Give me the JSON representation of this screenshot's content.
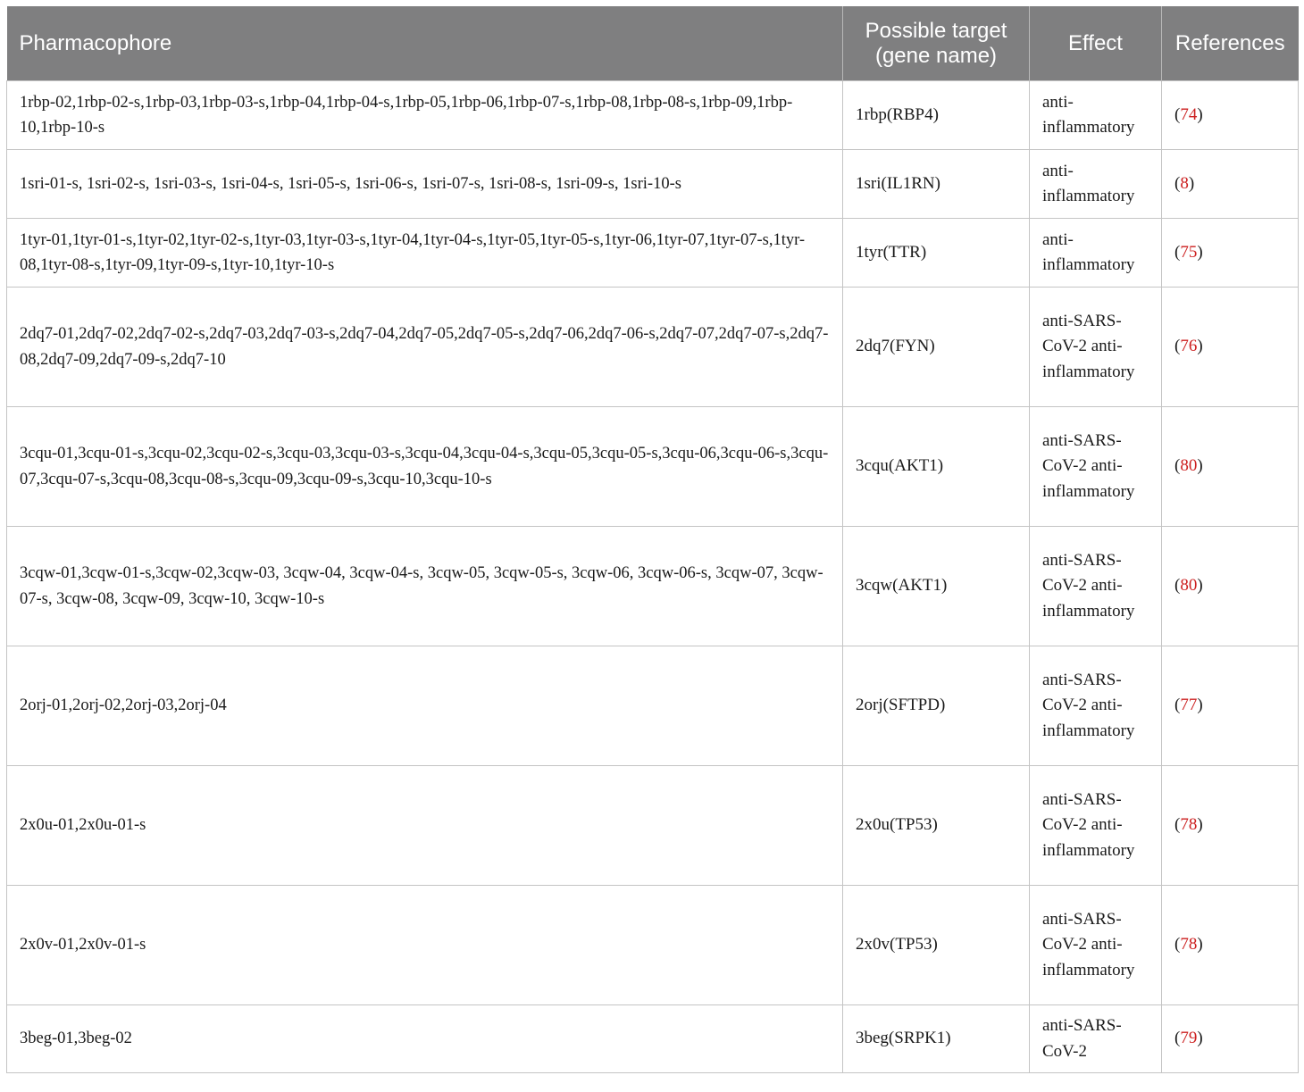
{
  "table": {
    "headers": [
      "Pharmacophore",
      "Possible target (gene name)",
      "Effect",
      "References"
    ],
    "rows": [
      {
        "pharmacophore": "1rbp-02,1rbp-02-s,1rbp-03,1rbp-03-s,1rbp-04,1rbp-04-s,1rbp-05,1rbp-06,1rbp-07-s,1rbp-08,1rbp-08-s,1rbp-09,1rbp-10,1rbp-10-s",
        "target": "1rbp(RBP4)",
        "effect": "anti-inflammatory",
        "ref": "74"
      },
      {
        "pharmacophore": "1sri-01-s, 1sri-02-s, 1sri-03-s, 1sri-04-s, 1sri-05-s, 1sri-06-s, 1sri-07-s, 1sri-08-s, 1sri-09-s, 1sri-10-s",
        "target": "1sri(IL1RN)",
        "effect": "anti-inflammatory",
        "ref": "8"
      },
      {
        "pharmacophore": "1tyr-01,1tyr-01-s,1tyr-02,1tyr-02-s,1tyr-03,1tyr-03-s,1tyr-04,1tyr-04-s,1tyr-05,1tyr-05-s,1tyr-06,1tyr-07,1tyr-07-s,1tyr-08,1tyr-08-s,1tyr-09,1tyr-09-s,1tyr-10,1tyr-10-s",
        "target": "1tyr(TTR)",
        "effect": "anti-inflammatory",
        "ref": "75"
      },
      {
        "pharmacophore": "2dq7-01,2dq7-02,2dq7-02-s,2dq7-03,2dq7-03-s,2dq7-04,2dq7-05,2dq7-05-s,2dq7-06,2dq7-06-s,2dq7-07,2dq7-07-s,2dq7-08,2dq7-09,2dq7-09-s,2dq7-10",
        "target": "2dq7(FYN)",
        "effect": "anti-SARS-CoV-2 anti-inflammatory",
        "ref": "76"
      },
      {
        "pharmacophore": "3cqu-01,3cqu-01-s,3cqu-02,3cqu-02-s,3cqu-03,3cqu-03-s,3cqu-04,3cqu-04-s,3cqu-05,3cqu-05-s,3cqu-06,3cqu-06-s,3cqu-07,3cqu-07-s,3cqu-08,3cqu-08-s,3cqu-09,3cqu-09-s,3cqu-10,3cqu-10-s",
        "target": "3cqu(AKT1)",
        "effect": "anti-SARS-CoV-2 anti-inflammatory",
        "ref": "80"
      },
      {
        "pharmacophore": "3cqw-01,3cqw-01-s,3cqw-02,3cqw-03, 3cqw-04, 3cqw-04-s, 3cqw-05, 3cqw-05-s, 3cqw-06, 3cqw-06-s, 3cqw-07, 3cqw-07-s, 3cqw-08, 3cqw-09, 3cqw-10, 3cqw-10-s",
        "target": "3cqw(AKT1)",
        "effect": "anti-SARS-CoV-2 anti-inflammatory",
        "ref": "80"
      },
      {
        "pharmacophore": "2orj-01,2orj-02,2orj-03,2orj-04",
        "target": "2orj(SFTPD)",
        "effect": "anti-SARS-CoV-2 anti-inflammatory",
        "ref": "77"
      },
      {
        "pharmacophore": "2x0u-01,2x0u-01-s",
        "target": "2x0u(TP53)",
        "effect": "anti-SARS-CoV-2 anti-inflammatory",
        "ref": "78"
      },
      {
        "pharmacophore": "2x0v-01,2x0v-01-s",
        "target": "2x0v(TP53)",
        "effect": "anti-SARS-CoV-2 anti-inflammatory",
        "ref": "78"
      },
      {
        "pharmacophore": "3beg-01,3beg-02",
        "target": "3beg(SRPK1)",
        "effect": "anti-SARS-CoV-2",
        "ref": "79"
      }
    ]
  }
}
